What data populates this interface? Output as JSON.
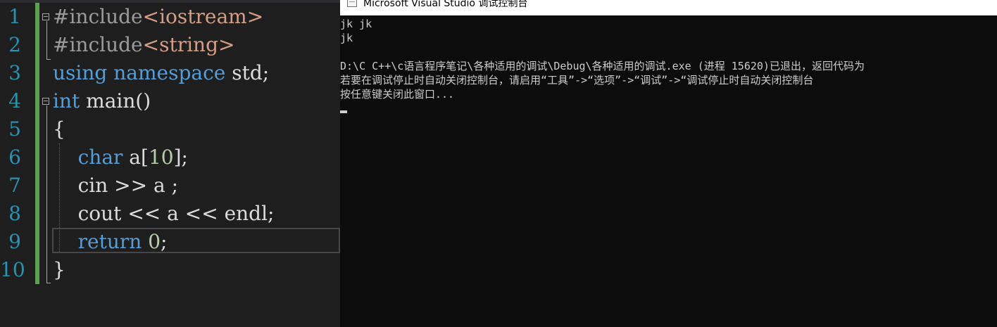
{
  "editor": {
    "line_numbers": [
      "1",
      "2",
      "3",
      "4",
      "5",
      "6",
      "7",
      "8",
      "9",
      "10"
    ],
    "lines": [
      {
        "segments": [
          {
            "text": "#include",
            "cls": "pp"
          },
          {
            "text": "<iostream>",
            "cls": "str"
          }
        ]
      },
      {
        "segments": [
          {
            "text": "#include",
            "cls": "pp"
          },
          {
            "text": "<string>",
            "cls": "str"
          }
        ]
      },
      {
        "segments": [
          {
            "text": "using",
            "cls": "kw"
          },
          {
            "text": " ",
            "cls": "plain"
          },
          {
            "text": "namespace",
            "cls": "kw"
          },
          {
            "text": " std;",
            "cls": "plain"
          }
        ]
      },
      {
        "segments": [
          {
            "text": "int",
            "cls": "kw"
          },
          {
            "text": " main()",
            "cls": "plain"
          }
        ]
      },
      {
        "segments": [
          {
            "text": "{",
            "cls": "plain"
          }
        ]
      },
      {
        "segments": [
          {
            "text": "    ",
            "cls": "plain"
          },
          {
            "text": "char",
            "cls": "kw"
          },
          {
            "text": " a[",
            "cls": "plain"
          },
          {
            "text": "10",
            "cls": "num"
          },
          {
            "text": "];",
            "cls": "plain"
          }
        ]
      },
      {
        "segments": [
          {
            "text": "    cin >> a ;",
            "cls": "plain"
          }
        ]
      },
      {
        "segments": [
          {
            "text": "    cout << a << endl;",
            "cls": "plain"
          }
        ]
      },
      {
        "segments": [
          {
            "text": "    ",
            "cls": "plain"
          },
          {
            "text": "return",
            "cls": "kw"
          },
          {
            "text": " ",
            "cls": "plain"
          },
          {
            "text": "0",
            "cls": "num"
          },
          {
            "text": ";",
            "cls": "plain"
          }
        ]
      },
      {
        "segments": [
          {
            "text": "}",
            "cls": "plain"
          }
        ]
      }
    ]
  },
  "console": {
    "title": "Microsoft Visual Studio 调试控制台",
    "lines": [
      "jk jk",
      "jk",
      "",
      "D:\\C C++\\c语言程序笔记\\各种适用的调试\\Debug\\各种适用的调试.exe (进程 15620)已退出，返回代码为",
      "若要在调试停止时自动关闭控制台，请启用“工具”->“选项”->“调试”->“调试停止时自动关闭控制台",
      "按任意键关闭此窗口..."
    ]
  }
}
